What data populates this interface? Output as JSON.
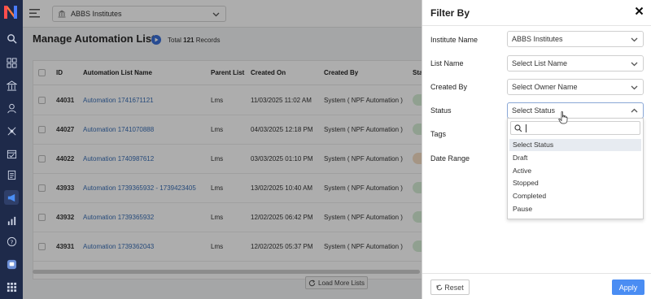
{
  "topbar": {
    "institute": "ABBS Institutes"
  },
  "page": {
    "title": "Manage Automation List",
    "total_prefix": "Total",
    "total_count": "121",
    "total_suffix": "Records"
  },
  "table": {
    "columns": [
      "ID",
      "Automation List Name",
      "Parent List",
      "Created On",
      "Created By",
      "Sta"
    ],
    "rows": [
      {
        "id": "44031",
        "name": "Automation 1741671121",
        "parent": "Lms",
        "created_on": "11/03/2025 11:02 AM",
        "created_by": "System ( NPF Automation )"
      },
      {
        "id": "44027",
        "name": "Automation 1741070888",
        "parent": "Lms",
        "created_on": "04/03/2025 12:18 PM",
        "created_by": "System ( NPF Automation )"
      },
      {
        "id": "44022",
        "name": "Automation 1740987612",
        "parent": "Lms",
        "created_on": "03/03/2025 01:10 PM",
        "created_by": "System ( NPF Automation )"
      },
      {
        "id": "43933",
        "name": "Automation 1739365932 - 1739423405",
        "parent": "Lms",
        "created_on": "13/02/2025 10:40 AM",
        "created_by": "System ( NPF Automation )"
      },
      {
        "id": "43932",
        "name": "Automation 1739365932",
        "parent": "Lms",
        "created_on": "12/02/2025 06:42 PM",
        "created_by": "System ( NPF Automation )"
      },
      {
        "id": "43931",
        "name": "Automation 1739362043",
        "parent": "Lms",
        "created_on": "12/02/2025 05:37 PM",
        "created_by": "System ( NPF Automation )"
      }
    ],
    "load_more": "Load More Lists"
  },
  "filter": {
    "title": "Filter By",
    "institute_label": "Institute Name",
    "institute_value": "ABBS Institutes",
    "list_name_label": "List Name",
    "list_name_value": "Select List Name",
    "created_by_label": "Created By",
    "created_by_value": "Select Owner Name",
    "status_label": "Status",
    "status_value": "Select Status",
    "tags_label": "Tags",
    "date_range_label": "Date Range",
    "status_options": [
      "Select Status",
      "Draft",
      "Active",
      "Stopped",
      "Completed",
      "Pause"
    ],
    "reset": "Reset",
    "apply": "Apply"
  },
  "colors": {
    "rail": "#1e2a4a",
    "link": "#3a6fb5",
    "apply": "#4a8df3",
    "status_pill": "#d4ecd4"
  },
  "icons": [
    "menu-icon",
    "bank-icon",
    "chevron-down-icon",
    "search-icon",
    "home-icon",
    "building-icon",
    "user-icon",
    "network-icon",
    "calendar-icon",
    "document-icon",
    "megaphone-icon",
    "chart-icon",
    "help-icon",
    "chat-icon",
    "apps-icon",
    "play-icon",
    "refresh-icon",
    "close-icon",
    "reset-icon"
  ]
}
